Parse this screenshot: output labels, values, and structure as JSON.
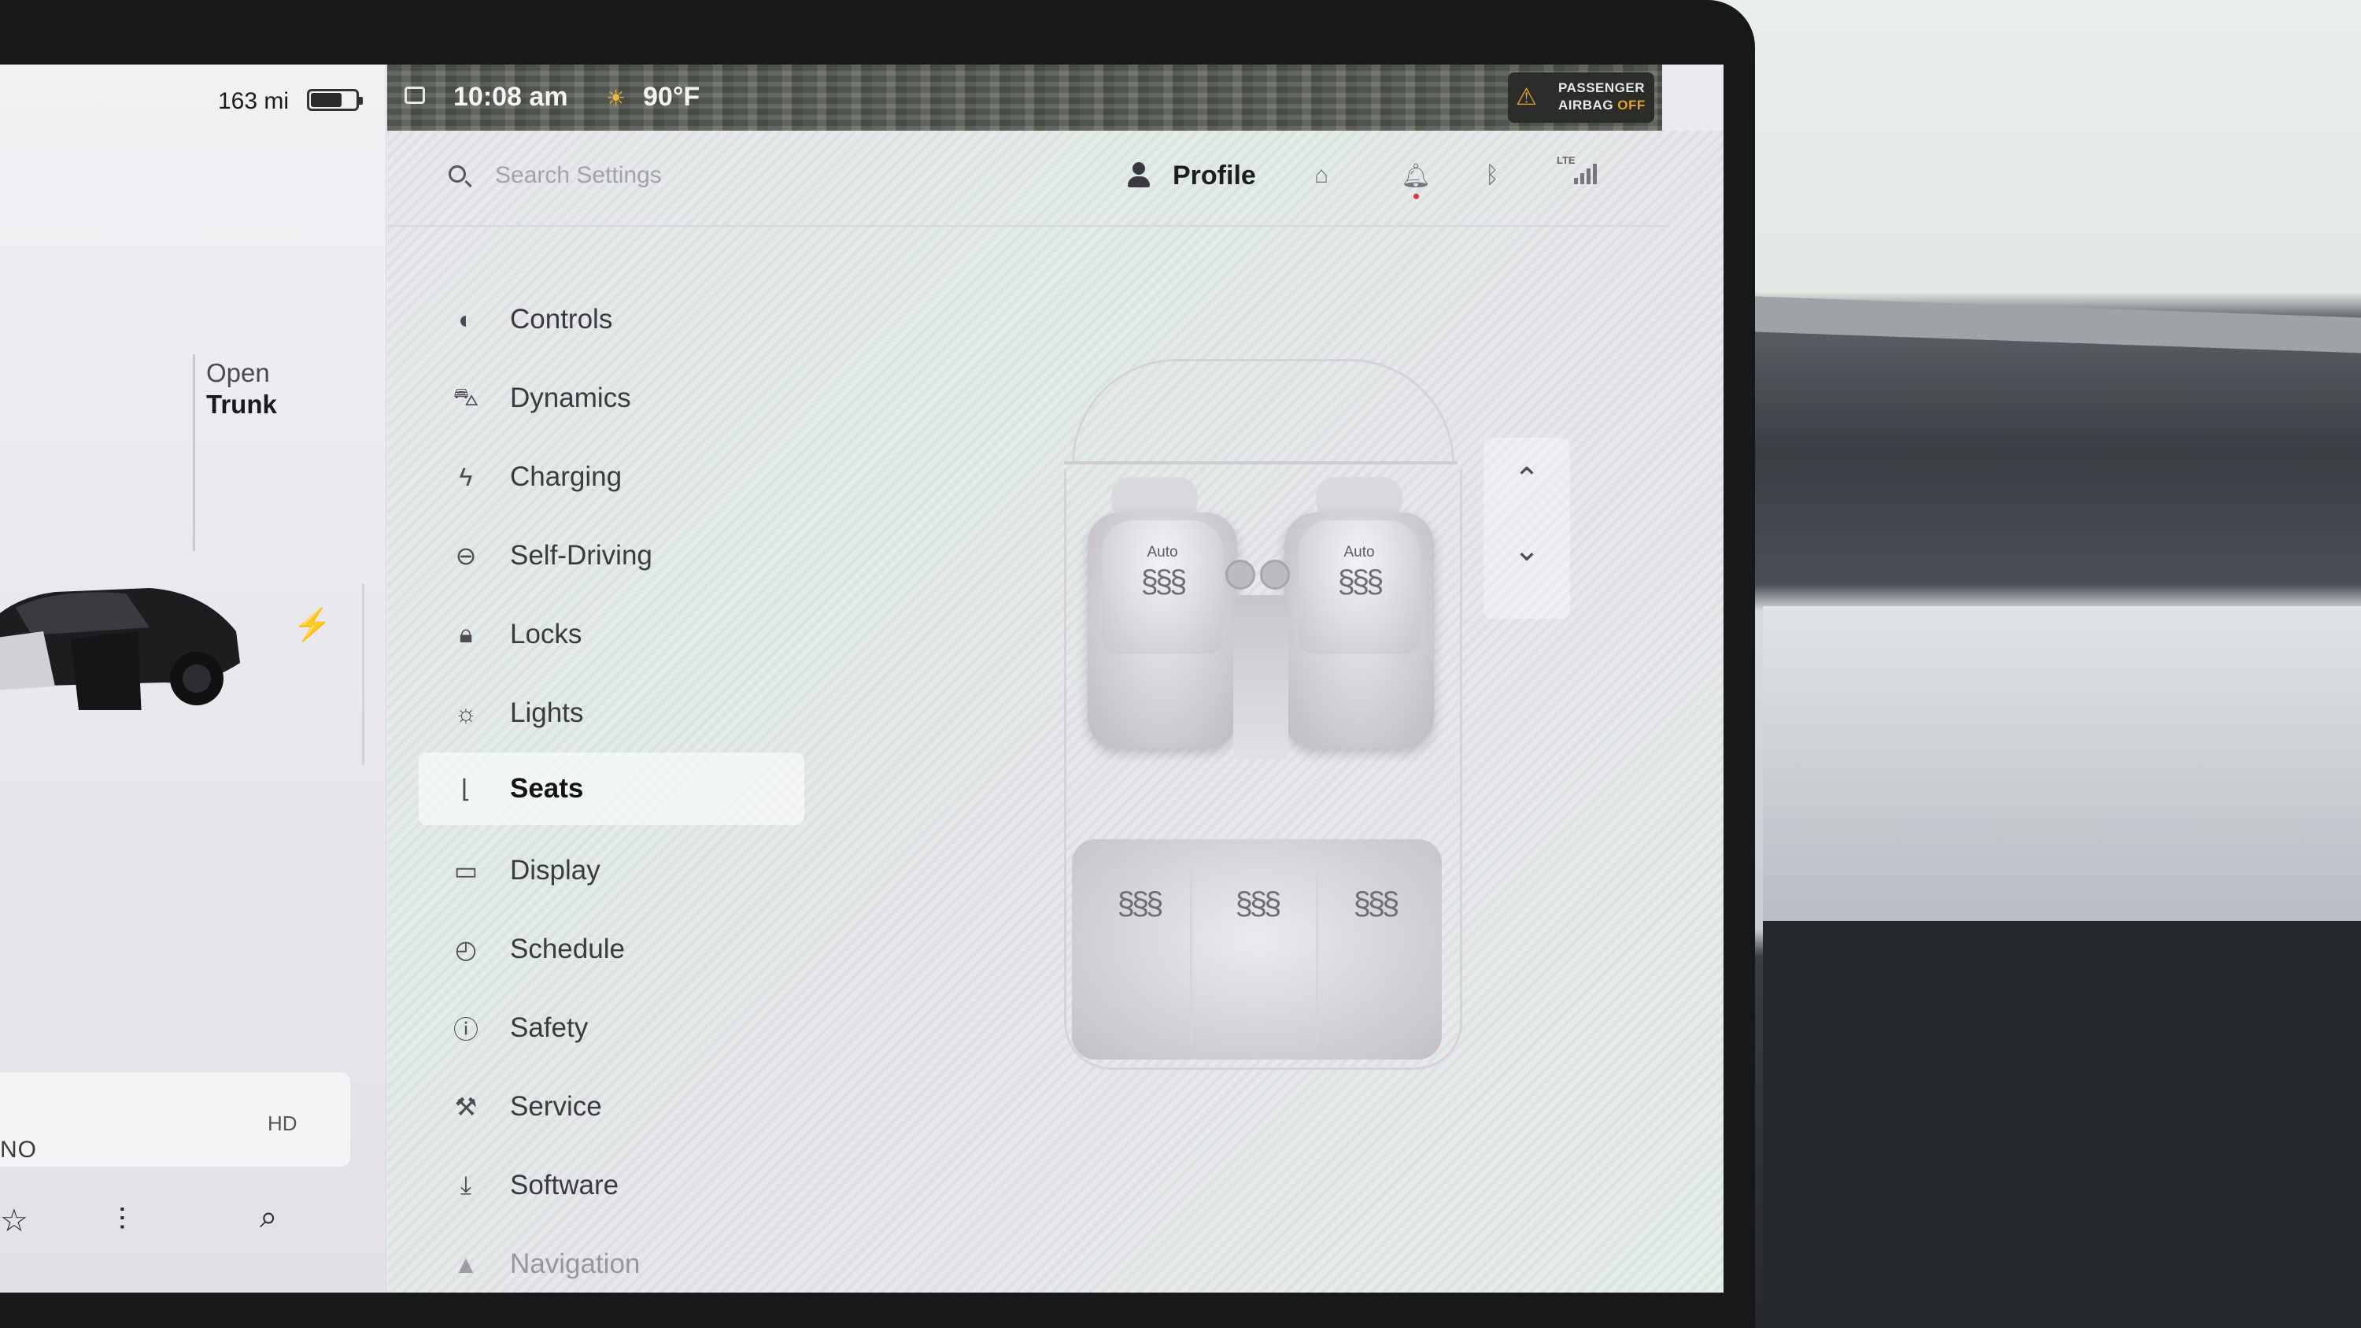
{
  "status_bar": {
    "range": "163 mi",
    "battery_level": 0.7,
    "time": "10:08 am",
    "temperature": "90°F",
    "airbag_line1": "PASSENGER",
    "airbag_line2_prefix": "AIRBAG",
    "airbag_line2_state": "OFF"
  },
  "car_panel": {
    "trunk_line1": "Open",
    "trunk_line2": "Trunk",
    "media_text": "NO",
    "media_badge": "HD"
  },
  "header": {
    "search_placeholder": "Search Settings",
    "profile_label": "Profile",
    "lte_label": "LTE"
  },
  "menu": [
    {
      "label": "Controls",
      "icon": "toggle-icon"
    },
    {
      "label": "Dynamics",
      "icon": "car-icon"
    },
    {
      "label": "Charging",
      "icon": "bolt-icon"
    },
    {
      "label": "Self-Driving",
      "icon": "steering-wheel-icon"
    },
    {
      "label": "Locks",
      "icon": "lock-icon"
    },
    {
      "label": "Lights",
      "icon": "sun-icon"
    },
    {
      "label": "Seats",
      "icon": "seat-icon",
      "active": true
    },
    {
      "label": "Display",
      "icon": "display-icon"
    },
    {
      "label": "Schedule",
      "icon": "clock-icon"
    },
    {
      "label": "Safety",
      "icon": "alert-circle-icon"
    },
    {
      "label": "Service",
      "icon": "wrench-icon"
    },
    {
      "label": "Software",
      "icon": "download-icon"
    },
    {
      "label": "Navigation",
      "icon": "navigation-arrow-icon"
    }
  ],
  "seats": {
    "driver_mode": "Auto",
    "passenger_mode": "Auto"
  },
  "colors": {
    "accent_warning": "#e6a12c",
    "notification_dot": "#d93636"
  }
}
